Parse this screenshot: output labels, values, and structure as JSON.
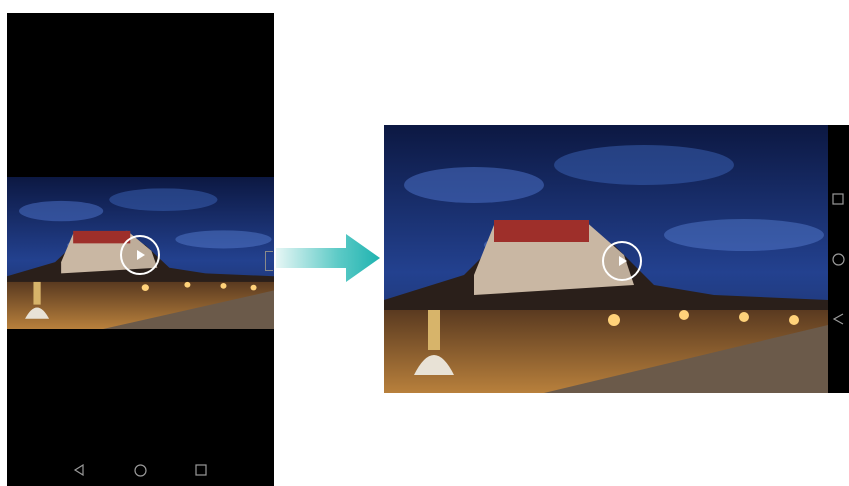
{
  "scene": {
    "description_icons": [
      "play-icon",
      "back-icon",
      "home-icon",
      "recents-icon",
      "arrow-right-icon"
    ]
  },
  "colors": {
    "phone_bezel": "#000000",
    "arrow_start": "#d9f1f0",
    "arrow_end": "#1fb3b0",
    "sky_top": "#0c1842",
    "sky_mid": "#23418f",
    "ground_light": "#f0a53a"
  },
  "portrait_phone": {
    "orientation": "portrait",
    "video": {
      "state": "paused",
      "play_icon": "play-icon"
    },
    "nav_bar": {
      "buttons": [
        "back-icon",
        "home-icon",
        "recents-icon"
      ]
    }
  },
  "landscape_phone": {
    "orientation": "landscape",
    "video": {
      "state": "paused",
      "play_icon": "play-icon"
    },
    "nav_bar": {
      "buttons": [
        "recents-icon",
        "home-icon",
        "back-icon"
      ]
    }
  }
}
